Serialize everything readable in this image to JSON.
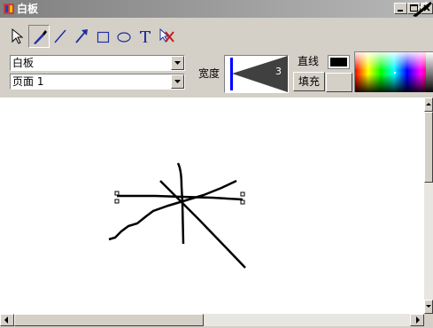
{
  "window": {
    "title": "白板"
  },
  "toolbar": {
    "tools": [
      {
        "name": "select-arrow-icon"
      },
      {
        "name": "pen-icon"
      },
      {
        "name": "line-icon"
      },
      {
        "name": "arrow-line-icon"
      },
      {
        "name": "rectangle-icon"
      },
      {
        "name": "ellipse-icon"
      },
      {
        "name": "text-icon"
      },
      {
        "name": "delete-icon"
      }
    ]
  },
  "board_select": {
    "value": "白板"
  },
  "page_select": {
    "value": "页面 1"
  },
  "width": {
    "label": "宽度",
    "value": "3"
  },
  "line_label": "直线",
  "fill_button": "填充",
  "colors": {
    "current": "#000000",
    "accent_blue": "#0000ff"
  }
}
